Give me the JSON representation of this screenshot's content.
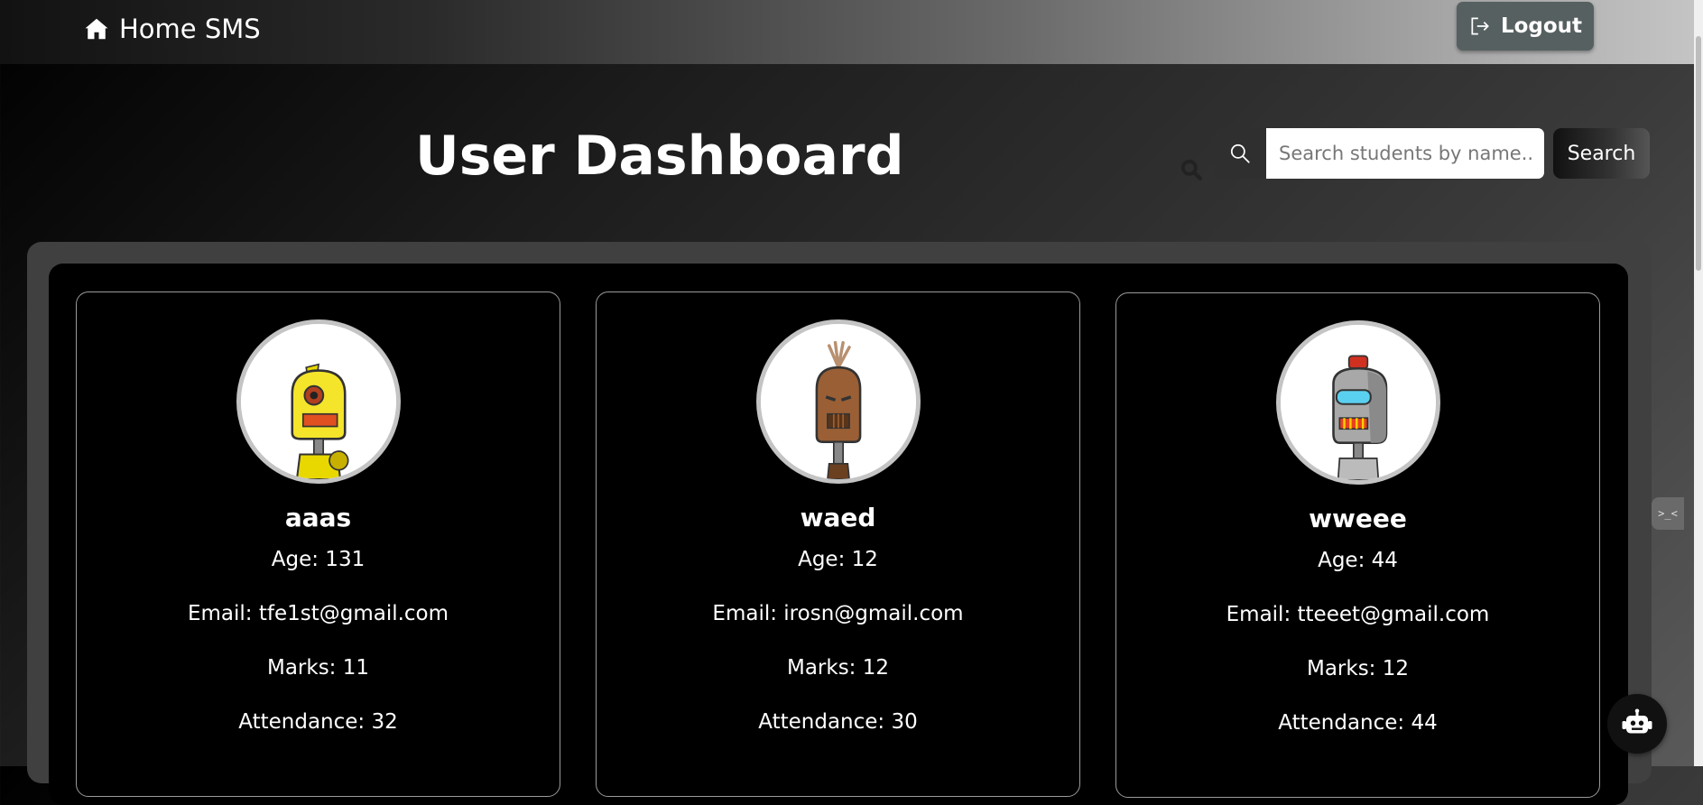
{
  "navbar": {
    "brand": "Home SMS",
    "brand_icon": "home-icon",
    "logout_label": "Logout",
    "logout_icon": "logout-icon"
  },
  "header": {
    "title": "User Dashboard"
  },
  "search": {
    "placeholder": "Search students by name...",
    "button_label": "Search",
    "icon": "search-icon"
  },
  "students": [
    {
      "name": "aaas",
      "age": "Age: 131",
      "email": "Email: tfe1st@gmail.com",
      "marks": "Marks: 11",
      "attendance": "Attendance: 32",
      "avatar": "yellow-robot-avatar"
    },
    {
      "name": "waed",
      "age": "Age: 12",
      "email": "Email: irosn@gmail.com",
      "marks": "Marks: 12",
      "attendance": "Attendance: 30",
      "avatar": "brown-robot-avatar"
    },
    {
      "name": "wweee",
      "age": "Age: 44",
      "email": "Email: tteeet@gmail.com",
      "marks": "Marks: 12",
      "attendance": "Attendance: 44",
      "avatar": "gray-robot-avatar"
    }
  ],
  "widgets": {
    "side_tab_text": ">_<",
    "chatbot_icon": "robot-icon"
  },
  "colors": {
    "logout_bg": "#566060",
    "avatar_ring": "#c4c4c4",
    "card_border": "#9a9a9a"
  }
}
